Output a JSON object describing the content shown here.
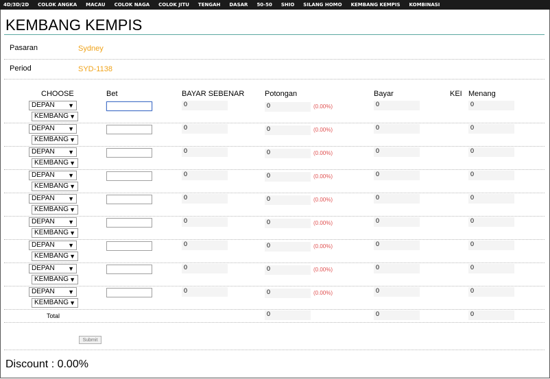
{
  "nav": [
    "4D/3D/2D",
    "COLOK ANGKA",
    "MACAU",
    "COLOK NAGA",
    "COLOK JITU",
    "TENGAH",
    "DASAR",
    "50-50",
    "SHIO",
    "SILANG HOMO",
    "KEMBANG KEMPIS",
    "KOMBINASI"
  ],
  "page": {
    "title": "KEMBANG KEMPIS"
  },
  "info": {
    "pasaran_label": "Pasaran",
    "pasaran_value": "Sydney",
    "period_label": "Period",
    "period_value": "SYD-1138"
  },
  "columns": {
    "choose": "CHOOSE",
    "bet": "Bet",
    "bayar_sebenar": "BAYAR SEBENAR",
    "potongan": "Potongan",
    "bayar": "Bayar",
    "kei": "KEI",
    "menang": "Menang"
  },
  "rows": [
    {
      "posisi": "DEPAN",
      "jenis": "KEMBANG",
      "bet": "",
      "bayar_sebenar": "0",
      "potongan": "0",
      "potongan_pct": "(0.00%)",
      "bayar": "0",
      "menang": "0"
    },
    {
      "posisi": "DEPAN",
      "jenis": "KEMBANG",
      "bet": "",
      "bayar_sebenar": "0",
      "potongan": "0",
      "potongan_pct": "(0.00%)",
      "bayar": "0",
      "menang": "0"
    },
    {
      "posisi": "DEPAN",
      "jenis": "KEMBANG",
      "bet": "",
      "bayar_sebenar": "0",
      "potongan": "0",
      "potongan_pct": "(0.00%)",
      "bayar": "0",
      "menang": "0"
    },
    {
      "posisi": "DEPAN",
      "jenis": "KEMBANG",
      "bet": "",
      "bayar_sebenar": "0",
      "potongan": "0",
      "potongan_pct": "(0.00%)",
      "bayar": "0",
      "menang": "0"
    },
    {
      "posisi": "DEPAN",
      "jenis": "KEMBANG",
      "bet": "",
      "bayar_sebenar": "0",
      "potongan": "0",
      "potongan_pct": "(0.00%)",
      "bayar": "0",
      "menang": "0"
    },
    {
      "posisi": "DEPAN",
      "jenis": "KEMBANG",
      "bet": "",
      "bayar_sebenar": "0",
      "potongan": "0",
      "potongan_pct": "(0.00%)",
      "bayar": "0",
      "menang": "0"
    },
    {
      "posisi": "DEPAN",
      "jenis": "KEMBANG",
      "bet": "",
      "bayar_sebenar": "0",
      "potongan": "0",
      "potongan_pct": "(0.00%)",
      "bayar": "0",
      "menang": "0"
    },
    {
      "posisi": "DEPAN",
      "jenis": "KEMBANG",
      "bet": "",
      "bayar_sebenar": "0",
      "potongan": "0",
      "potongan_pct": "(0.00%)",
      "bayar": "0",
      "menang": "0"
    },
    {
      "posisi": "DEPAN",
      "jenis": "KEMBANG",
      "bet": "",
      "bayar_sebenar": "0",
      "potongan": "0",
      "potongan_pct": "(0.00%)",
      "bayar": "0",
      "menang": "0"
    }
  ],
  "totals": {
    "label": "Total",
    "potongan": "0",
    "bayar": "0",
    "menang": "0"
  },
  "submit_label": "Submit",
  "discount_text": "Discount : 0.00%",
  "colors": {
    "accent": "#f0a31a",
    "nav_bg": "#1b1b1b",
    "percent": "#e05050",
    "title_rule": "#5aa7a0"
  }
}
